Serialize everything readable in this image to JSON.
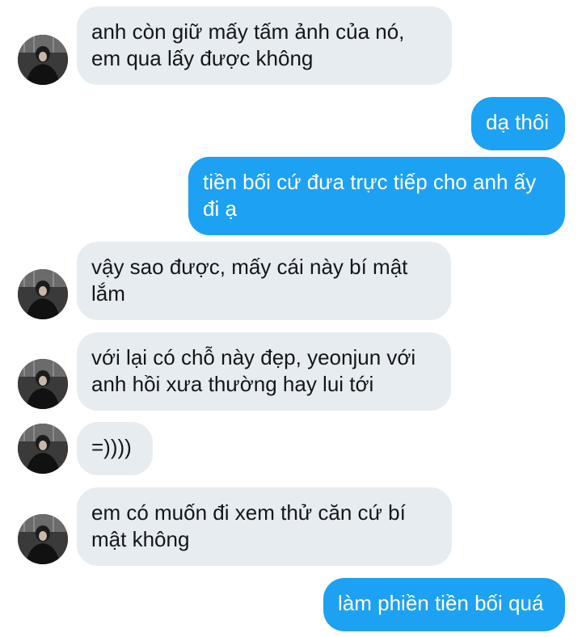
{
  "conversation": {
    "messages": [
      {
        "side": "in",
        "text": "anh còn giữ mấy tấm ảnh của nó,\nem qua lấy được không"
      },
      {
        "side": "out",
        "text": "dạ thôi"
      },
      {
        "side": "out",
        "text": "tiền bối cứ đưa trực tiếp cho anh ấy\nđi ạ"
      },
      {
        "side": "in",
        "text": "vậy sao được, mấy cái này bí mật\nlắm"
      },
      {
        "side": "in",
        "text": "với lại có chỗ này đẹp, yeonjun với\nanh hồi xưa thường hay lui tới"
      },
      {
        "side": "in",
        "text": "=))))"
      },
      {
        "side": "in",
        "text": "em có muốn đi xem thử căn cứ bí\nmật không"
      },
      {
        "side": "out",
        "text": "làm phiền tiền bối quá"
      }
    ]
  },
  "colors": {
    "incoming_bubble": "#e6ecf0",
    "outgoing_bubble": "#1da1f2",
    "incoming_text": "#14171a",
    "outgoing_text": "#ffffff"
  },
  "icons": {
    "avatar": "user-avatar-photo"
  }
}
